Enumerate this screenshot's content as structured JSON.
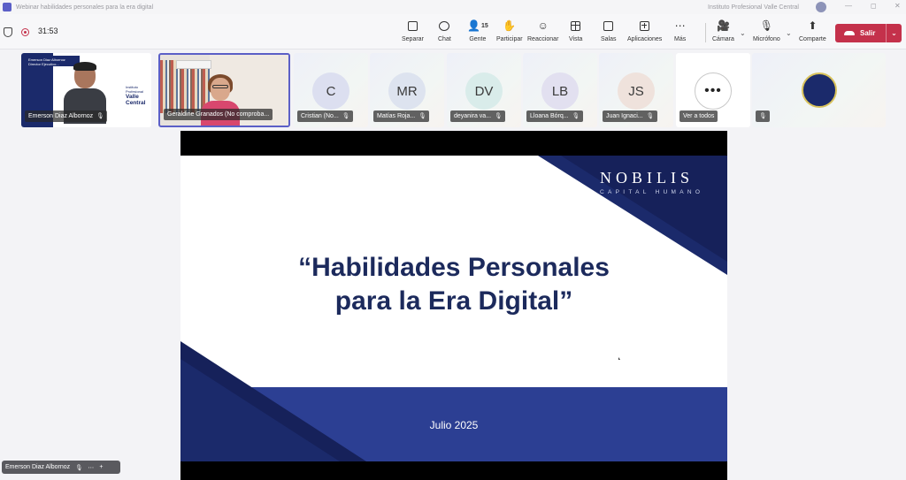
{
  "window": {
    "title": "Webinar habilidades personales para la era digital",
    "org": "Instituto Profesional Valle Central",
    "controls": [
      "—",
      "◻",
      "✕"
    ]
  },
  "toolbar": {
    "timer": "31:53",
    "items": [
      {
        "label": "Separar",
        "icon": "pop-out-icon"
      },
      {
        "label": "Chat",
        "icon": "chat-icon"
      },
      {
        "label": "Gente",
        "icon": "people-icon",
        "count": "15"
      },
      {
        "label": "Participar",
        "icon": "raise-hand-icon"
      },
      {
        "label": "Reaccionar",
        "icon": "smiley-icon"
      },
      {
        "label": "Vista",
        "icon": "grid-view-icon"
      },
      {
        "label": "Salas",
        "icon": "rooms-icon"
      },
      {
        "label": "Aplicaciones",
        "icon": "apps-icon"
      },
      {
        "label": "Más",
        "icon": "more-icon"
      }
    ],
    "camera_label": "Cámara",
    "mic_label": "Micrófono",
    "share_label": "Comparte",
    "leave_label": "Salir",
    "leave_color": "#c4314b"
  },
  "participants": [
    {
      "name": "Emerson Diaz Albornoz",
      "type": "video"
    },
    {
      "name": "Geraldine Granados (No comproba...",
      "type": "video"
    },
    {
      "name": "Cristian (No...",
      "initials": "C",
      "color": "#dcdff0"
    },
    {
      "name": "Matías Roja...",
      "initials": "MR",
      "color": "#dde3ef"
    },
    {
      "name": "deyanira va...",
      "initials": "DV",
      "color": "#d9ecea"
    },
    {
      "name": "Lloana Bórq...",
      "initials": "LB",
      "color": "#e2e0f0"
    },
    {
      "name": "Juan Ignaci...",
      "initials": "JS",
      "color": "#efe2dc"
    },
    {
      "name": "Ver a todos",
      "type": "see-all",
      "more": "•••"
    }
  ],
  "emerson_banner": {
    "line1": "Emerson Diaz Albornoz",
    "line2": "Director Ejecutivo..."
  },
  "emerson_logo": {
    "small": "Instituto Profesional",
    "big": "Valle Central"
  },
  "slide": {
    "brand": "NOBILIS",
    "brand_sub": "CAPITAL HUMANO",
    "title_line1": "“Habilidades Personales",
    "title_line2": "para la Era Digital”",
    "date": "Julio 2025",
    "accent_color": "#1b2a6b",
    "band_color": "#2c3f93"
  },
  "presenter": {
    "name": "Emerson Diaz Albornoz"
  }
}
